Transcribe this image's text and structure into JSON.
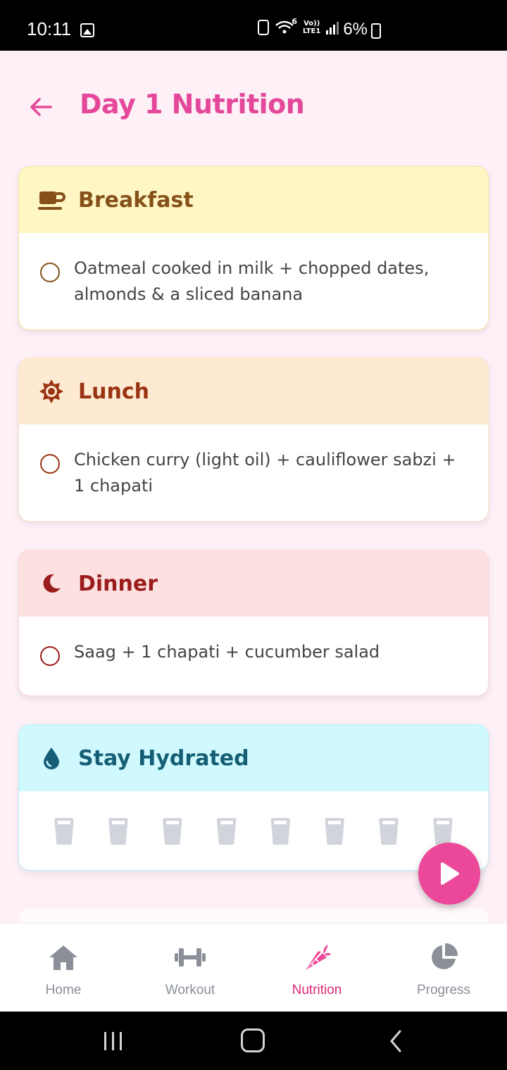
{
  "status_bar": {
    "time": "10:11",
    "battery": "6%",
    "volte_top": "Vo))",
    "volte_bottom": "LTE1",
    "wifi_badge": "6"
  },
  "header": {
    "title": "Day 1 Nutrition"
  },
  "meals": {
    "breakfast": {
      "title": "Breakfast",
      "icon": "coffee-cup-icon",
      "item": "Oatmeal cooked in milk + chopped dates, almonds & a sliced banana"
    },
    "lunch": {
      "title": "Lunch",
      "icon": "sun-icon",
      "item": "Chicken curry (light oil) + cauliflower sabzi + 1 chapati"
    },
    "dinner": {
      "title": "Dinner",
      "icon": "moon-icon",
      "item": "Saag + 1 chapati + cucumber salad"
    }
  },
  "hydration": {
    "title": "Stay Hydrated",
    "icon": "water-drop-icon",
    "glasses_total": 8,
    "glasses_filled": 0
  },
  "bottom_nav": {
    "items": [
      {
        "label": "Home",
        "icon": "home-icon",
        "active": false
      },
      {
        "label": "Workout",
        "icon": "dumbbell-icon",
        "active": false
      },
      {
        "label": "Nutrition",
        "icon": "carrot-icon",
        "active": true
      },
      {
        "label": "Progress",
        "icon": "pie-chart-icon",
        "active": false
      }
    ]
  },
  "colors": {
    "accent": "#e5489a",
    "fab": "#ec4899",
    "inactive_nav": "#8a8f98",
    "background": "#fdf0f6"
  }
}
